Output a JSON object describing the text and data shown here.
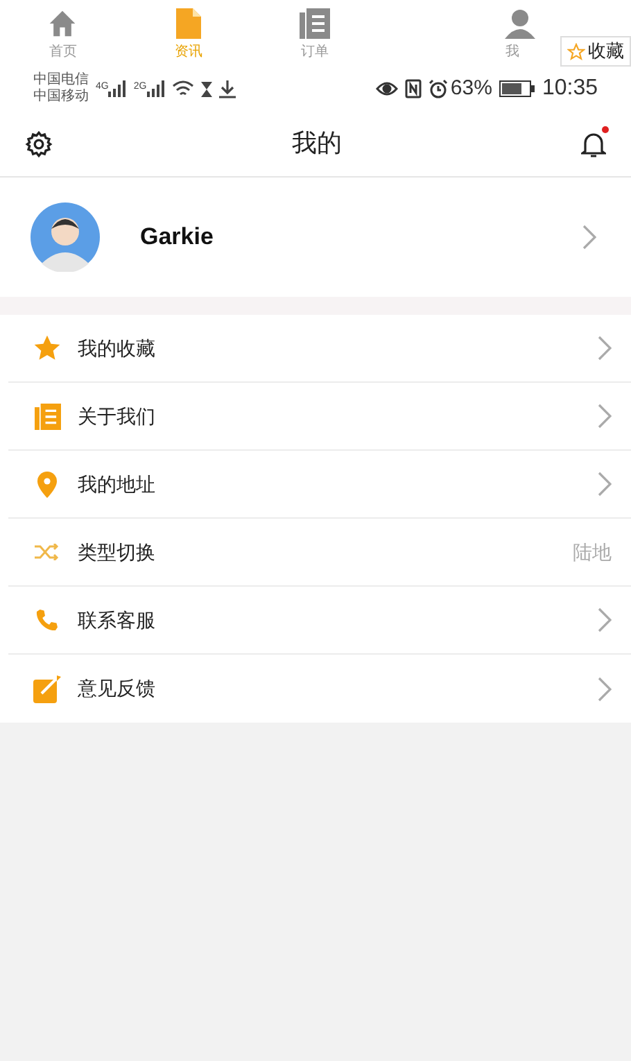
{
  "tabs": [
    {
      "label": "首页",
      "selected": false
    },
    {
      "label": "资讯",
      "selected": true
    },
    {
      "label": "订单",
      "selected": false
    },
    {
      "label": "我",
      "selected": false
    }
  ],
  "favorite_popup": {
    "label": "收藏"
  },
  "status_bar": {
    "carriers": [
      "中国电信",
      "中国移动"
    ],
    "networks": [
      "4G",
      "2G"
    ],
    "battery": "63%",
    "time": "10:35"
  },
  "header": {
    "title": "我的",
    "notification_dot": true
  },
  "profile": {
    "name": "Garkie"
  },
  "menu": [
    {
      "label": "我的收藏",
      "kind": "arrow"
    },
    {
      "label": "关于我们",
      "kind": "arrow"
    },
    {
      "label": "我的地址",
      "kind": "arrow"
    },
    {
      "label": "类型切换",
      "kind": "value",
      "value": "陆地"
    },
    {
      "label": "联系客服",
      "kind": "arrow"
    },
    {
      "label": "意见反馈",
      "kind": "arrow"
    }
  ]
}
